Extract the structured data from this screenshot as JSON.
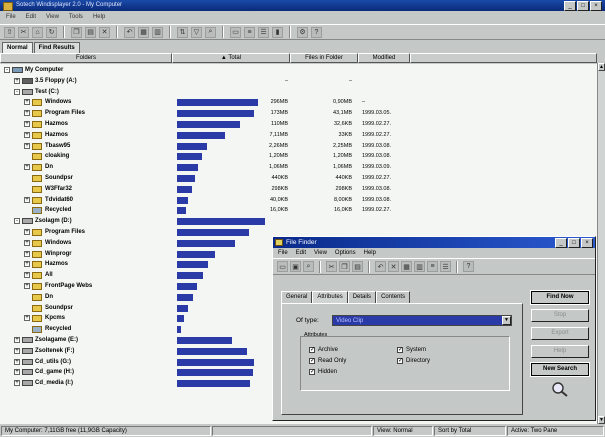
{
  "window": {
    "title": "Sotech Windisplayer 2.0 - My Computer"
  },
  "menu": [
    "File",
    "Edit",
    "View",
    "Tools",
    "Help"
  ],
  "tabs": [
    {
      "label": "Normal",
      "active": true
    },
    {
      "label": "Find Results",
      "active": false
    }
  ],
  "columns": {
    "folders": "Folders",
    "total": "Total",
    "files": "Files in Folder",
    "modified": "Modified"
  },
  "tree": [
    {
      "name": "My Computer",
      "indent": 0,
      "kind": "computer",
      "expand": "-",
      "bar": 0,
      "total": "",
      "files": "",
      "modified": ""
    },
    {
      "name": "3.5 Floppy (A:)",
      "indent": 1,
      "kind": "floppy",
      "expand": "+",
      "bar": 0,
      "total": "–",
      "files": "–",
      "modified": ""
    },
    {
      "name": "Test (C:)",
      "indent": 1,
      "kind": "drive",
      "expand": "-",
      "bar": 0,
      "total": "",
      "files": "",
      "modified": ""
    },
    {
      "name": "Windows",
      "indent": 2,
      "kind": "folder",
      "expand": "+",
      "bar": 0.92,
      "total": "296MB",
      "files": "0,90MB",
      "modified": "–"
    },
    {
      "name": "Program Files",
      "indent": 2,
      "kind": "folder",
      "expand": "+",
      "bar": 0.87,
      "total": "173MB",
      "files": "43,1MB",
      "modified": "1999.03.05."
    },
    {
      "name": "Hazmos",
      "indent": 2,
      "kind": "folder",
      "expand": "+",
      "bar": 0.72,
      "total": "110MB",
      "files": "32,6KB",
      "modified": "1999.02.27."
    },
    {
      "name": "Hazmos",
      "indent": 2,
      "kind": "folder",
      "expand": "+",
      "bar": 0.55,
      "total": "7,11MB",
      "files": "33KB",
      "modified": "1999.02.27."
    },
    {
      "name": "Tbasw95",
      "indent": 2,
      "kind": "folder",
      "expand": "+",
      "bar": 0.34,
      "total": "2,26MB",
      "files": "2,25MB",
      "modified": "1999.03.08."
    },
    {
      "name": "cloaking",
      "indent": 2,
      "kind": "folder",
      "expand": "",
      "bar": 0.28,
      "total": "1,20MB",
      "files": "1,20MB",
      "modified": "1999.03.08."
    },
    {
      "name": "Dn",
      "indent": 2,
      "kind": "folder",
      "expand": "+",
      "bar": 0.24,
      "total": "1,06MB",
      "files": "1,06MB",
      "modified": "1999.03.09."
    },
    {
      "name": "Soundpsr",
      "indent": 2,
      "kind": "folder",
      "expand": "",
      "bar": 0.2,
      "total": "440KB",
      "files": "440KB",
      "modified": "1999.02.27."
    },
    {
      "name": "W3Ffar32",
      "indent": 2,
      "kind": "folder",
      "expand": "",
      "bar": 0.17,
      "total": "298KB",
      "files": "298KB",
      "modified": "1999.03.08."
    },
    {
      "name": "Tdvidat60",
      "indent": 2,
      "kind": "folder",
      "expand": "+",
      "bar": 0.13,
      "total": "40,0KB",
      "files": "8,00KB",
      "modified": "1999.03.08."
    },
    {
      "name": "Recycled",
      "indent": 2,
      "kind": "recycle",
      "expand": "",
      "bar": 0.1,
      "total": "16,0KB",
      "files": "16,0KB",
      "modified": "1999.02.27."
    },
    {
      "name": "Zsolagm (D:)",
      "indent": 1,
      "kind": "drive",
      "expand": "-",
      "bar": 1.0,
      "total": "",
      "files": "",
      "modified": ""
    },
    {
      "name": "Program Files",
      "indent": 2,
      "kind": "folder",
      "expand": "+",
      "bar": 0.82,
      "total": "",
      "files": "",
      "modified": ""
    },
    {
      "name": "Windows",
      "indent": 2,
      "kind": "folder",
      "expand": "+",
      "bar": 0.66,
      "total": "",
      "files": "",
      "modified": ""
    },
    {
      "name": "Winprogr",
      "indent": 2,
      "kind": "folder",
      "expand": "+",
      "bar": 0.43,
      "total": "",
      "files": "",
      "modified": ""
    },
    {
      "name": "Hazmos",
      "indent": 2,
      "kind": "folder",
      "expand": "+",
      "bar": 0.35,
      "total": "",
      "files": "",
      "modified": ""
    },
    {
      "name": "All",
      "indent": 2,
      "kind": "folder",
      "expand": "+",
      "bar": 0.29,
      "total": "",
      "files": "",
      "modified": ""
    },
    {
      "name": "FrontPage Webs",
      "indent": 2,
      "kind": "folder",
      "expand": "+",
      "bar": 0.23,
      "total": "",
      "files": "",
      "modified": ""
    },
    {
      "name": "Dn",
      "indent": 2,
      "kind": "folder",
      "expand": "",
      "bar": 0.18,
      "total": "",
      "files": "",
      "modified": ""
    },
    {
      "name": "Soundpsr",
      "indent": 2,
      "kind": "folder",
      "expand": "",
      "bar": 0.13,
      "total": "",
      "files": "",
      "modified": ""
    },
    {
      "name": "Kpcms",
      "indent": 2,
      "kind": "folder",
      "expand": "+",
      "bar": 0.08,
      "total": "",
      "files": "",
      "modified": ""
    },
    {
      "name": "Recycled",
      "indent": 2,
      "kind": "recycle",
      "expand": "",
      "bar": 0.05,
      "total": "",
      "files": "",
      "modified": ""
    },
    {
      "name": "Zsolagame (E:)",
      "indent": 1,
      "kind": "drive",
      "expand": "+",
      "bar": 0.62,
      "total": "",
      "files": "",
      "modified": ""
    },
    {
      "name": "Zsoltenek (F:)",
      "indent": 1,
      "kind": "drive",
      "expand": "+",
      "bar": 0.8,
      "total": "",
      "files": "",
      "modified": ""
    },
    {
      "name": "Cd_utils (G:)",
      "indent": 1,
      "kind": "drive",
      "expand": "+",
      "bar": 0.88,
      "total": "",
      "files": "",
      "modified": ""
    },
    {
      "name": "Cd_game (H:)",
      "indent": 1,
      "kind": "drive",
      "expand": "+",
      "bar": 0.86,
      "total": "",
      "files": "",
      "modified": ""
    },
    {
      "name": "Cd_media (I:)",
      "indent": 1,
      "kind": "drive",
      "expand": "+",
      "bar": 0.83,
      "total": "",
      "files": "",
      "modified": ""
    }
  ],
  "status": {
    "left": "My Computer: 7,11GB free (11,9GB Capacity)",
    "view": "View: Normal",
    "sort": "Sort by Total",
    "active": "Active: Two Pane"
  },
  "dialog": {
    "title": "File Finder",
    "menu": [
      "File",
      "Edit",
      "View",
      "Options",
      "Help"
    ],
    "tabs": [
      {
        "label": "General",
        "active": false
      },
      {
        "label": "Attributes",
        "active": true
      },
      {
        "label": "Details",
        "active": false
      },
      {
        "label": "Contents",
        "active": false
      }
    ],
    "of_type_label": "Of type:",
    "of_type_value": "Video Clip",
    "attributes_label": "Attributes",
    "checks": [
      {
        "label": "Archive",
        "checked": true
      },
      {
        "label": "Read Only",
        "checked": true
      },
      {
        "label": "Hidden",
        "checked": true
      },
      {
        "label": "System",
        "checked": true
      },
      {
        "label": "Directory",
        "checked": true
      }
    ],
    "buttons": [
      {
        "label": "Find Now",
        "enabled": true,
        "bold": true
      },
      {
        "label": "Stop",
        "enabled": false
      },
      {
        "label": "Export",
        "enabled": false
      },
      {
        "label": "Help",
        "enabled": false
      },
      {
        "label": "New Search",
        "enabled": true,
        "bold": true
      }
    ]
  },
  "colors": {
    "bar": "#2a3aa6",
    "title": "#1a4aa8",
    "folder": "#e8c84a"
  }
}
